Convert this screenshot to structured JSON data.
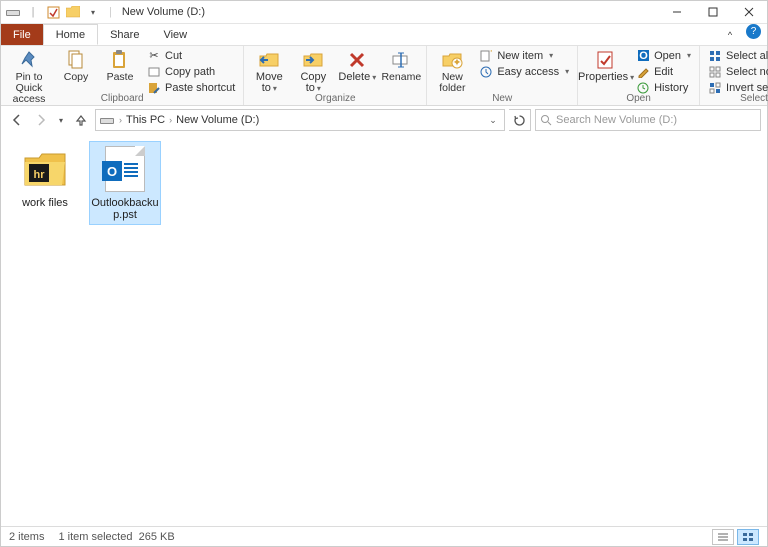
{
  "window_title": "New Volume (D:)",
  "tabs": {
    "file": "File",
    "home": "Home",
    "share": "Share",
    "view": "View"
  },
  "ribbon": {
    "pin": "Pin to Quick access",
    "copy": "Copy",
    "paste": "Paste",
    "cut": "Cut",
    "copy_path": "Copy path",
    "paste_shortcut": "Paste shortcut",
    "clipboard": "Clipboard",
    "move_to": "Move to",
    "copy_to": "Copy to",
    "delete": "Delete",
    "rename": "Rename",
    "organize": "Organize",
    "new_folder": "New folder",
    "new_item": "New item",
    "easy_access": "Easy access",
    "new": "New",
    "properties": "Properties",
    "open": "Open",
    "edit": "Edit",
    "history": "History",
    "open_group": "Open",
    "select_all": "Select all",
    "select_none": "Select none",
    "invert_selection": "Invert selection",
    "select": "Select"
  },
  "breadcrumb": {
    "this_pc": "This PC",
    "location": "New Volume (D:)"
  },
  "search": {
    "placeholder": "Search New Volume (D:)"
  },
  "items": [
    {
      "name": "work files",
      "type": "folder"
    },
    {
      "name": "Outlookbackup.pst",
      "type": "pst"
    }
  ],
  "status": {
    "count": "2 items",
    "selected": "1 item selected",
    "size": "265 KB"
  }
}
